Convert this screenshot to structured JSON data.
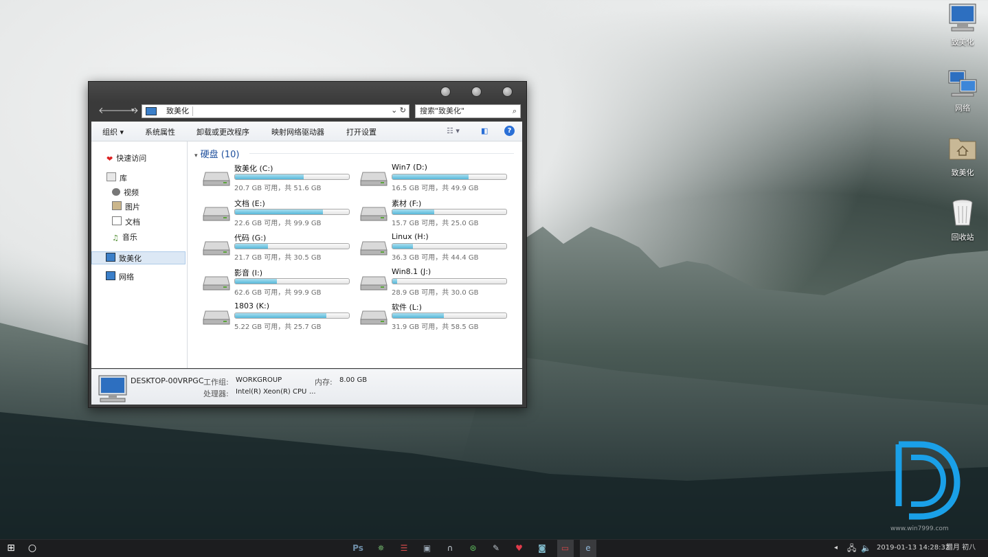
{
  "desktop": {
    "icons": [
      {
        "label": "致美化",
        "icon": "computer-icon"
      },
      {
        "label": "网络",
        "icon": "network-icon"
      },
      {
        "label": "致美化",
        "icon": "home-folder-icon"
      },
      {
        "label": "回收站",
        "icon": "recycle-bin-icon"
      }
    ]
  },
  "window": {
    "address": {
      "location": "致美化"
    },
    "search": {
      "placeholder": "搜索\"致美化\""
    },
    "toolbar": {
      "organize": "组织",
      "system_properties": "系统属性",
      "uninstall": "卸载或更改程序",
      "map_drive": "映射网络驱动器",
      "open_settings": "打开设置"
    },
    "nav": {
      "quick_access": "快速访问",
      "library": "库",
      "videos": "视频",
      "pictures": "图片",
      "documents": "文档",
      "music": "音乐",
      "this_pc": "致美化",
      "network": "网络"
    },
    "group_title": "硬盘 (10)",
    "drives": [
      {
        "name": "致美化 (C:)",
        "free": "20.7 GB 可用，共 51.6 GB",
        "used_fraction": 0.6
      },
      {
        "name": "Win7 (D:)",
        "free": "16.5 GB 可用，共 49.9 GB",
        "used_fraction": 0.67
      },
      {
        "name": "文档 (E:)",
        "free": "22.6 GB 可用，共 99.9 GB",
        "used_fraction": 0.77
      },
      {
        "name": "素材 (F:)",
        "free": "15.7 GB 可用，共 25.0 GB",
        "used_fraction": 0.37
      },
      {
        "name": "代码 (G:)",
        "free": "21.7 GB 可用，共 30.5 GB",
        "used_fraction": 0.29
      },
      {
        "name": "Linux (H:)",
        "free": "36.3 GB 可用，共 44.4 GB",
        "used_fraction": 0.18
      },
      {
        "name": "影音 (I:)",
        "free": "62.6 GB 可用，共 99.9 GB",
        "used_fraction": 0.37
      },
      {
        "name": "Win8.1 (J:)",
        "free": "28.9 GB 可用，共 30.0 GB",
        "used_fraction": 0.04
      },
      {
        "name": "1803 (K:)",
        "free": "5.22 GB 可用，共 25.7 GB",
        "used_fraction": 0.8
      },
      {
        "name": "软件 (L:)",
        "free": "31.9 GB 可用，共 58.5 GB",
        "used_fraction": 0.45
      }
    ],
    "details": {
      "computer_name": "DESKTOP-00VRPGC",
      "workgroup_label": "工作组:",
      "workgroup": "WORKGROUP",
      "memory_label": "内存:",
      "memory": "8.00 GB",
      "processor_label": "处理器:",
      "processor": "Intel(R) Xeon(R) CPU",
      "processor_more": "..."
    }
  },
  "taskbar": {
    "apps": [
      {
        "icon": "photoshop-icon",
        "text": "Ps"
      },
      {
        "icon": "gear-icon",
        "text": "✵"
      },
      {
        "icon": "app-red-icon",
        "text": "☰"
      },
      {
        "icon": "window-app-icon",
        "text": "▣"
      },
      {
        "icon": "headphones-icon",
        "text": "∩"
      },
      {
        "icon": "refresh-app-icon",
        "text": "⊛"
      },
      {
        "icon": "notepad-icon",
        "text": "✎"
      },
      {
        "icon": "heart-icon",
        "text": "♥"
      },
      {
        "icon": "camera-icon",
        "text": "◙"
      },
      {
        "icon": "computer-app-icon",
        "text": "▭"
      },
      {
        "icon": "edge-icon",
        "text": "e"
      }
    ],
    "tray": {
      "datetime": "2019-01-13  14:28:32",
      "lunar": "腊月 初八"
    }
  },
  "watermark": "www.win7999.com"
}
